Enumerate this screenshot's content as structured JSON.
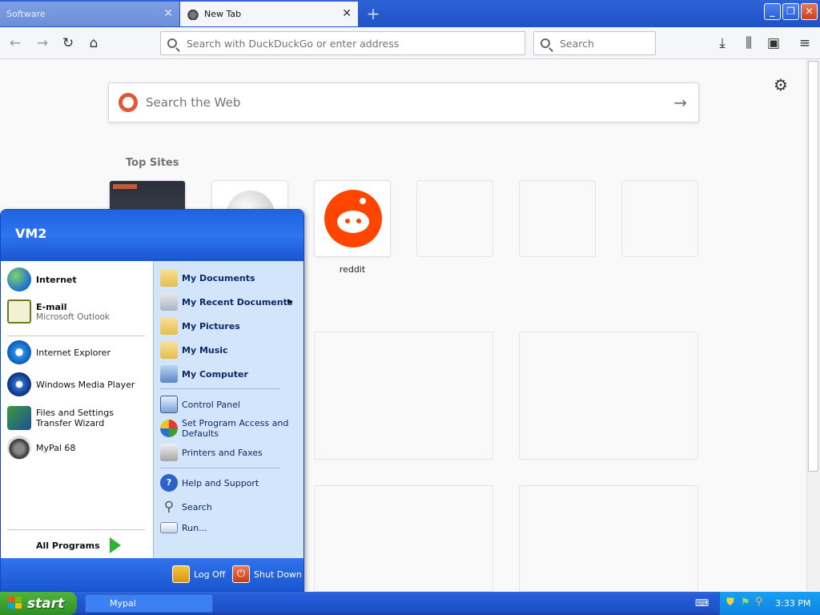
{
  "tabs": [
    {
      "label": "Software",
      "active": false
    },
    {
      "label": "New Tab",
      "active": true
    }
  ],
  "new_tab_symbol": "+",
  "window_controls": {
    "minimize": "_",
    "maximize": "❐",
    "close": "✕"
  },
  "navbar": {
    "url_placeholder": "Search with DuckDuckGo or enter address",
    "search_placeholder": "Search"
  },
  "newtab": {
    "web_search_placeholder": "Search the Web",
    "top_sites_label": "Top Sites",
    "reddit_label": "reddit"
  },
  "start_menu": {
    "user": "VM2",
    "pinned": [
      {
        "label": "Internet"
      },
      {
        "label": "E-mail",
        "sub": "Microsoft Outlook"
      }
    ],
    "recent": [
      {
        "label": "Internet Explorer"
      },
      {
        "label": "Windows Media Player"
      },
      {
        "label": "Files and Settings Transfer Wizard"
      },
      {
        "label": "MyPal 68"
      }
    ],
    "all_programs": "All Programs",
    "places": [
      {
        "label": "My Documents"
      },
      {
        "label": "My Recent Documents"
      },
      {
        "label": "My Pictures"
      },
      {
        "label": "My Music"
      },
      {
        "label": "My Computer"
      }
    ],
    "system": [
      {
        "label": "Control Panel"
      },
      {
        "label": "Set Program Access and Defaults"
      },
      {
        "label": "Printers and Faxes"
      }
    ],
    "help": [
      {
        "label": "Help and Support"
      },
      {
        "label": "Search"
      },
      {
        "label": "Run..."
      }
    ],
    "log_off": "Log Off",
    "shut_down": "Shut Down"
  },
  "taskbar": {
    "start_label": "start",
    "task_item": "Mypal",
    "clock": "3:33 PM"
  },
  "colors": {
    "xp_blue": "#245edb",
    "start_green": "#3c9e30",
    "reddit_orange": "#ff4500",
    "ddg_orange": "#de5833"
  }
}
